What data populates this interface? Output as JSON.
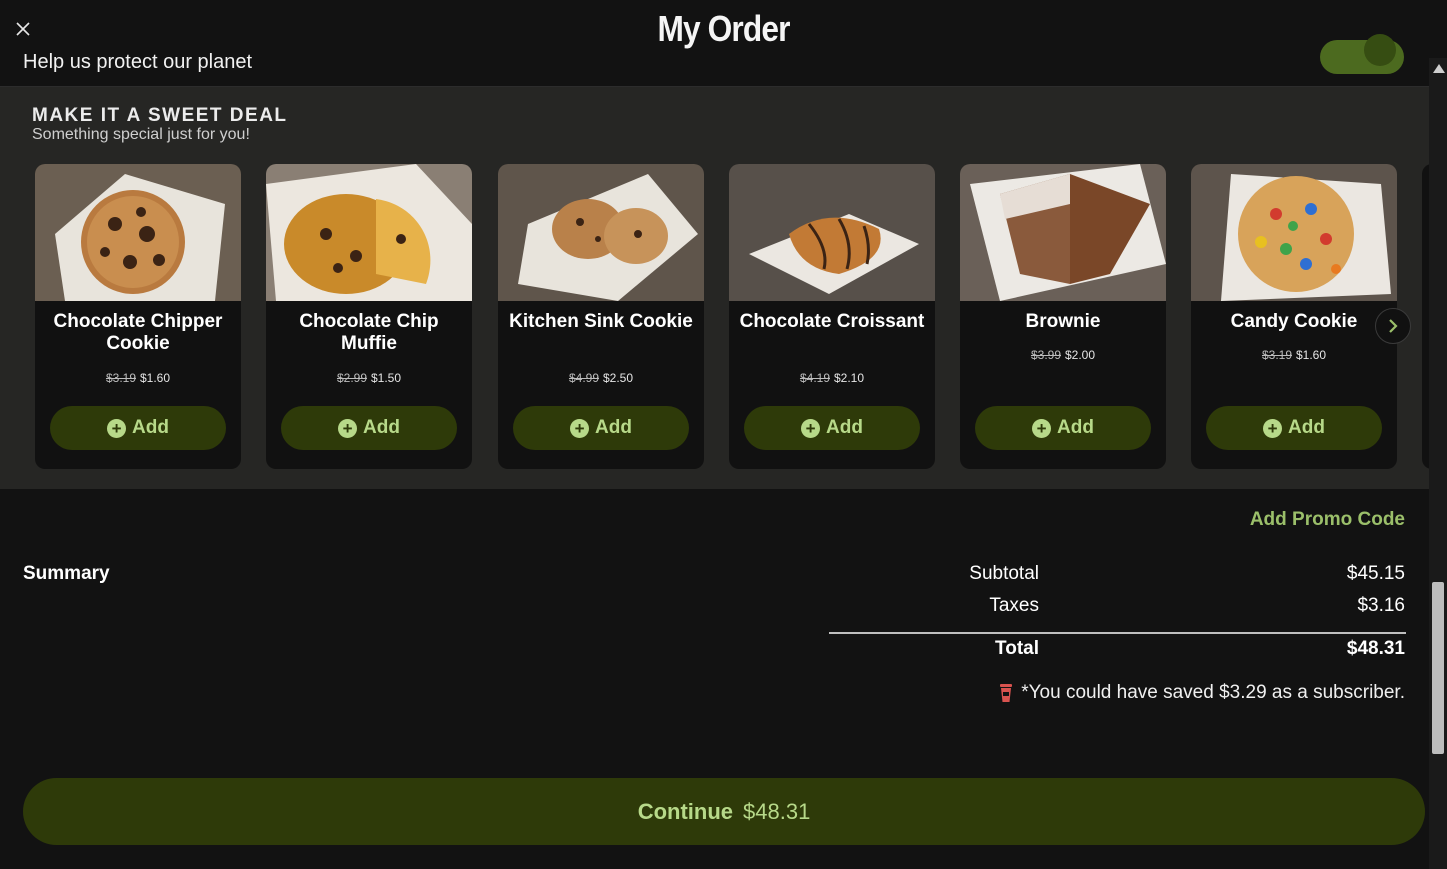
{
  "header": {
    "title": "My Order",
    "planet_text": "Help us protect our planet"
  },
  "upsell": {
    "title": "MAKE IT A SWEET DEAL",
    "subtitle": "Something special just for you!",
    "add_label": "Add",
    "plus_glyph": "+",
    "items": [
      {
        "name": "Chocolate Chipper Cookie",
        "old_price": "$3.19",
        "new_price": "$1.60",
        "icon": "chocolate-chipper-cookie-image"
      },
      {
        "name": "Chocolate Chip Muffie",
        "old_price": "$2.99",
        "new_price": "$1.50",
        "icon": "chocolate-chip-muffie-image"
      },
      {
        "name": "Kitchen Sink Cookie",
        "old_price": "$4.99",
        "new_price": "$2.50",
        "icon": "kitchen-sink-cookie-image"
      },
      {
        "name": "Chocolate Croissant",
        "old_price": "$4.19",
        "new_price": "$2.10",
        "icon": "chocolate-croissant-image"
      },
      {
        "name": "Brownie",
        "old_price": "$3.99",
        "new_price": "$2.00",
        "icon": "brownie-image"
      },
      {
        "name": "Candy Cookie",
        "old_price": "$3.19",
        "new_price": "$1.60",
        "icon": "candy-cookie-image"
      }
    ]
  },
  "summary": {
    "promo_label": "Add Promo Code",
    "label": "Summary",
    "subtotal_label": "Subtotal",
    "subtotal_value": "$45.15",
    "taxes_label": "Taxes",
    "taxes_value": "$3.16",
    "total_label": "Total",
    "total_value": "$48.31",
    "savings_text": "*You could have saved $3.29 as a subscriber."
  },
  "continue": {
    "label": "Continue",
    "amount": "$48.31"
  },
  "colors": {
    "accent": "#b7d989",
    "button_bg": "#2e3a09",
    "promo": "#9bbf6a",
    "cup_icon": "#d9534f"
  }
}
